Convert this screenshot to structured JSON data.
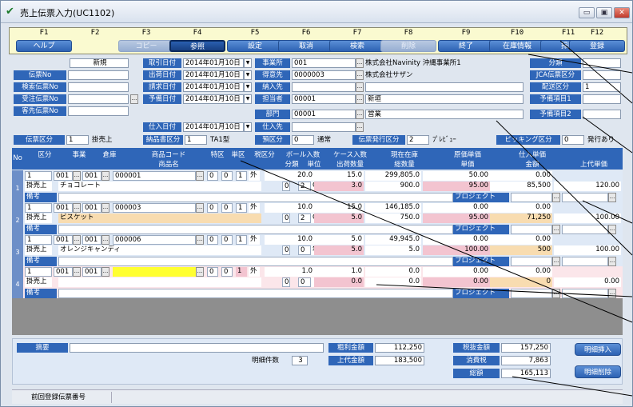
{
  "window": {
    "title": "売上伝票入力(UC1102)",
    "min": "▭",
    "max": "▣",
    "close": "✕"
  },
  "fkeys": [
    {
      "key": "F1",
      "label": "ヘルプ",
      "state": "on"
    },
    {
      "key": "F2",
      "label": "",
      "state": "none"
    },
    {
      "key": "F3",
      "label": "コピー",
      "state": "dis"
    },
    {
      "key": "F4",
      "label": "参照",
      "state": "act"
    },
    {
      "key": "F5",
      "label": "設定",
      "state": "on"
    },
    {
      "key": "F6",
      "label": "取消",
      "state": "on"
    },
    {
      "key": "F7",
      "label": "検索",
      "state": "on"
    },
    {
      "key": "F8",
      "label": "削除",
      "state": "dis"
    },
    {
      "key": "F9",
      "label": "終了",
      "state": "on"
    },
    {
      "key": "F10",
      "label": "在庫情報",
      "state": "on"
    },
    {
      "key": "F11",
      "label": "掃除",
      "state": "on"
    },
    {
      "key": "F12",
      "label": "登録",
      "state": "on"
    }
  ],
  "header": {
    "mode": "新規",
    "denpyo_no": "伝票No",
    "kensaku_no": "検索伝票No",
    "juchu_no": "受注伝票No",
    "kyaku_no": "客先伝票No",
    "torihiki_label": "取引日付",
    "torihiki": "2014年01月10日",
    "shukka_label": "出荷日付",
    "shukka": "2014年01月10日",
    "seikyu_label": "請求日付",
    "seikyu": "2014年01月10日",
    "yobi_label": "予備日付",
    "yobi": "2014年01月10日",
    "shiire_label": "仕入日付",
    "shiire": "2014年01月10日",
    "jigyosho_label": "事業所",
    "jigyosho_code": "001",
    "jigyosho_name": "株式会社Navinity 沖縄事業所1",
    "tokui_label": "得意先",
    "tokui_code": "0000003",
    "tokui_name": "株式会社サザン",
    "nonyu_label": "納入先",
    "tanto_label": "担当者",
    "tanto_code": "00001",
    "tanto_name": "新垣",
    "bumon_label": "部門",
    "bumon_code": "00001",
    "bumon_name": "営業",
    "shiiresaki_label": "仕入先",
    "bunrui_label": "分類",
    "jca_label": "JCA伝票区分",
    "haiso_label": "配送区分",
    "haiso_val": "1",
    "yobi1_label": "予備項目1",
    "yobi2_label": "予備項目2",
    "denpyo_kubun_label": "伝票区分",
    "denpyo_kubun_code": "1",
    "denpyo_kubun_name": "掛売上",
    "nohinsho_label": "納品書区分",
    "nohinsho_code": "1",
    "nohinsho_name": "TA1型",
    "yoshin_label": "預区分",
    "yoshin_code": "0",
    "yoshin_name": "通常",
    "hakko_label": "伝票発行区分",
    "hakko_code": "2",
    "hakko_name": "ﾌﾟﾚﾋﾞｭｰ",
    "picking_label": "ピッキング区分",
    "picking_code": "0",
    "picking_name": "発行あり"
  },
  "grid_header": {
    "no": "No",
    "kubun": "区分",
    "jigyo": "事業",
    "soko": "倉庫",
    "code": "商品コード",
    "name": "商品名",
    "tokku": "特区",
    "tani_ku": "単区",
    "zei": "税区分",
    "ball": "ボール入数",
    "bunrui": "分類",
    "tani": "単位",
    "case": "ケース入数",
    "shukka": "出荷数量",
    "zaiko": "現在在庫",
    "sosu": "総数量",
    "genka": "原価単価",
    "tanka": "単価",
    "shiire": "仕入単価",
    "kingaku": "金額",
    "jodai": "上代単価",
    "biko": "備考",
    "project": "プロジェクト"
  },
  "rows": [
    {
      "no": "1",
      "kubun": "1",
      "sub": "掛売上",
      "jigyo": "001",
      "soko": "001",
      "code": "000001",
      "name": "チョコレート",
      "t1": "0",
      "t2": "0",
      "zei": "1",
      "soto": "外",
      "ball": "20.0",
      "bun": "0",
      "tani_c": "2",
      "tani": "CS",
      "case": "15.0",
      "shukka": "3.0",
      "zaiko": "299,805.0",
      "sosu": "900.0",
      "genka": "50.00",
      "tanka": "95.00",
      "shiire": "0.00",
      "kingaku": "85,500",
      "jodai": "120.00"
    },
    {
      "no": "2",
      "kubun": "1",
      "sub": "掛売上",
      "jigyo": "001",
      "soko": "001",
      "code": "000003",
      "name": "ビスケット",
      "t1": "0",
      "t2": "0",
      "zei": "1",
      "soto": "外",
      "ball": "10.0",
      "bun": "0",
      "tani_c": "2",
      "tani": "CS",
      "case": "15.0",
      "shukka": "5.0",
      "zaiko": "146,185.0",
      "sosu": "750.0",
      "genka": "0.00",
      "tanka": "95.00",
      "shiire": "0.00",
      "kingaku": "71,250",
      "jodai": "100.00"
    },
    {
      "no": "3",
      "kubun": "1",
      "sub": "掛売上",
      "jigyo": "001",
      "soko": "001",
      "code": "000006",
      "name": "オレンジキャンディ",
      "t1": "0",
      "t2": "0",
      "zei": "1",
      "soto": "外",
      "ball": "10.0",
      "bun": "0",
      "tani_c": "0",
      "tani": "袋",
      "case": "5.0",
      "shukka": "5.0",
      "zaiko": "49,945.0",
      "sosu": "5.0",
      "genka": "0.00",
      "tanka": "100.00",
      "shiire": "0.00",
      "kingaku": "500",
      "jodai": "100.00"
    },
    {
      "no": "4",
      "kubun": "1",
      "sub": "掛売上",
      "jigyo": "001",
      "soko": "001",
      "code": "",
      "name": "",
      "t1": "0",
      "t2": "0",
      "zei": "1",
      "soto": "外",
      "ball": "1.0",
      "bun": "0",
      "tani_c": "0",
      "tani": "",
      "case": "1.0",
      "shukka": "0.0",
      "zaiko": "0.0",
      "sosu": "0.0",
      "genka": "0.00",
      "tanka": "0.00",
      "shiire": "0.00",
      "kingaku": "0",
      "jodai": "0.00"
    }
  ],
  "footer": {
    "tekiyo": "摘要",
    "meisai_label": "明細件数",
    "meisai": "3",
    "arari_label": "粗利金額",
    "arari": "112,250",
    "jodai_label": "上代金額",
    "jodai": "183,500",
    "zeinuki_label": "税抜金額",
    "zeinuki": "157,250",
    "shohizei_label": "消費税",
    "shohizei": "7,863",
    "sogaku_label": "総額",
    "sogaku": "165,113",
    "insert": "明細挿入",
    "delete": "明細削除"
  },
  "status": {
    "prev": "前回登録伝票番号"
  }
}
